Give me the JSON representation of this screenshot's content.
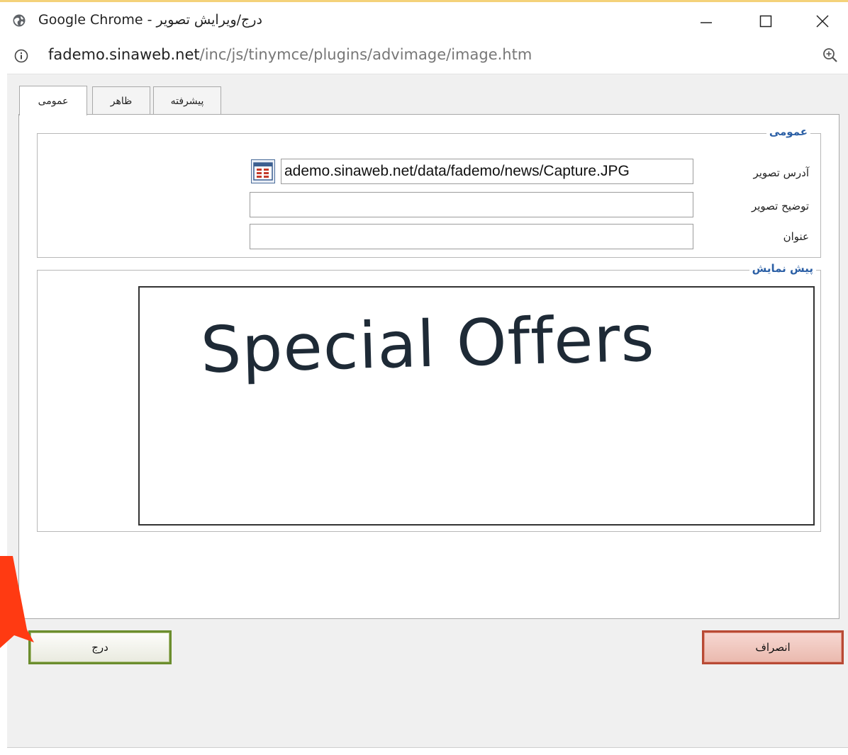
{
  "window": {
    "title": "Google Chrome - درج/ویرایش تصویر"
  },
  "urlbar": {
    "host": "fademo.sinaweb.net",
    "path": "/inc/js/tinymce/plugins/advimage/image.htm"
  },
  "tabs": [
    {
      "label": "عمومی",
      "active": true
    },
    {
      "label": "ظاهر",
      "active": false
    },
    {
      "label": "پیشرفته",
      "active": false
    }
  ],
  "general": {
    "legend": "عمومی",
    "fields": {
      "src_label": "آدرس تصویر",
      "src_value": "ademo.sinaweb.net/data/fademo/news/Capture.JPG",
      "alt_label": "توضیح تصویر",
      "alt_value": "",
      "title_label": "عنوان",
      "title_value": ""
    }
  },
  "preview": {
    "legend": "پیش نمایش",
    "image_text": "Special Offers"
  },
  "buttons": {
    "insert_label": "درج",
    "cancel_label": "انصراف"
  },
  "colors": {
    "legend_blue": "#2b5fa5",
    "insert_border": "#6b8d2e",
    "cancel_border": "#b84a35",
    "arrow_red": "#ff3a12"
  },
  "icons": {
    "globe": "globe-icon",
    "info": "info-icon",
    "zoom": "zoom-icon",
    "browse": "browse-icon",
    "minimize": "minimize-icon",
    "maximize": "maximize-icon",
    "close": "close-icon"
  }
}
